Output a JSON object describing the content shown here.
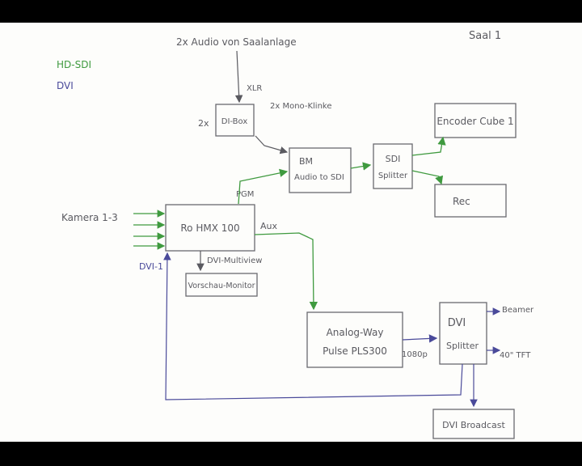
{
  "diagram": {
    "page_label": "Saal 1",
    "legend": [
      {
        "label": "HD-SDI",
        "color": "#3f9a3f"
      },
      {
        "label": "DVI",
        "color": "#4a4a9a"
      }
    ],
    "colors": {
      "ink": "#5a5a60",
      "hdsdi": "#3f9a3f",
      "dvi": "#4a4a9a"
    },
    "top_input": "2x Audio von Saalanlage",
    "xlr_label": "XLR",
    "mono_label": "2x Mono-Klinke",
    "di_multiplier": "2x",
    "kamera_label": "Kamera 1-3",
    "dvi1_label": "DVI-1",
    "pgm_label": "PGM",
    "aux_label": "Aux",
    "multiview_label": "DVI-Multiview",
    "res_label": "1080p",
    "beamer_label": "Beamer",
    "tft_label": "40\" TFT",
    "boxes": {
      "di_box": "DI-Box",
      "bm_line1": "BM",
      "bm_line2": "Audio to SDI",
      "sdi_line1": "SDI",
      "sdi_line2": "Splitter",
      "encoder": "Encoder Cube 1",
      "rec": "Rec",
      "mixer": "Ro HMX 100",
      "vorschau": "Vorschau-Monitor",
      "pulse_line1": "Analog-Way",
      "pulse_line2": "Pulse PLS300",
      "dvi_line1": "DVI",
      "dvi_line2": "Splitter",
      "dvi_broadcast": "DVI Broadcast"
    }
  }
}
